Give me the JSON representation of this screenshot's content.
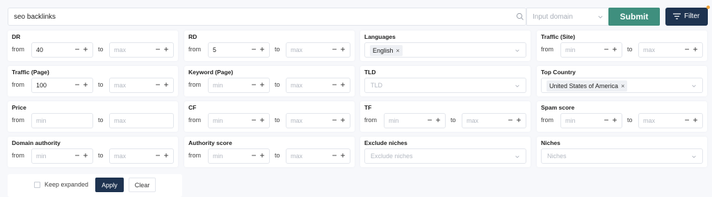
{
  "search": {
    "value": "seo backlinks"
  },
  "domain": {
    "placeholder": "Input domain"
  },
  "actions": {
    "submit": "Submit",
    "filter": "Filter"
  },
  "filters": {
    "dr": {
      "label": "DR",
      "from": "from",
      "to": "to",
      "min_value": "40",
      "max_placeholder": "max"
    },
    "rd": {
      "label": "RD",
      "from": "from",
      "to": "to",
      "min_value": "5",
      "max_placeholder": "max"
    },
    "languages": {
      "label": "Languages",
      "selected": "English"
    },
    "traffic_site": {
      "label": "Traffic (Site)",
      "from": "from",
      "to": "to",
      "min_placeholder": "min",
      "max_placeholder": "max"
    },
    "traffic_page": {
      "label": "Traffic (Page)",
      "from": "from",
      "to": "to",
      "min_value": "100",
      "max_placeholder": "max"
    },
    "keyword_page": {
      "label": "Keyword (Page)",
      "from": "from",
      "to": "to",
      "min_placeholder": "min",
      "max_placeholder": "max"
    },
    "tld": {
      "label": "TLD",
      "placeholder": "TLD"
    },
    "top_country": {
      "label": "Top Country",
      "selected": "United States of America"
    },
    "price": {
      "label": "Price",
      "from": "from",
      "to": "to",
      "min_placeholder": "min",
      "max_placeholder": "max"
    },
    "cf": {
      "label": "CF",
      "from": "from",
      "to": "to",
      "min_placeholder": "min",
      "max_placeholder": "max"
    },
    "tf": {
      "label": "TF",
      "from": "from",
      "to": "to",
      "min_placeholder": "min",
      "max_placeholder": "max"
    },
    "spam_score": {
      "label": "Spam score",
      "from": "from",
      "to": "to",
      "min_placeholder": "min",
      "max_placeholder": "max"
    },
    "domain_authority": {
      "label": "Domain authority",
      "from": "from",
      "to": "to",
      "min_placeholder": "min",
      "max_placeholder": "max"
    },
    "authority_score": {
      "label": "Authority score",
      "from": "from",
      "to": "to",
      "min_placeholder": "min",
      "max_placeholder": "max"
    },
    "exclude_niches": {
      "label": "Exclude niches",
      "placeholder": "Exclude niches"
    },
    "niches": {
      "label": "Niches",
      "placeholder": "Niches"
    }
  },
  "stepper": {
    "minus": "−",
    "plus": "+"
  },
  "tag_remove": "×",
  "footer": {
    "keep_expanded": "Keep expanded",
    "apply": "Apply",
    "clear": "Clear"
  },
  "colors": {
    "submit": "#3f8f7e",
    "navy": "#1e3350",
    "notification_dot": "#f0a33b"
  },
  "icons": {
    "search": "search-icon",
    "chevron": "chevron-down-icon",
    "filter": "filter-icon"
  }
}
